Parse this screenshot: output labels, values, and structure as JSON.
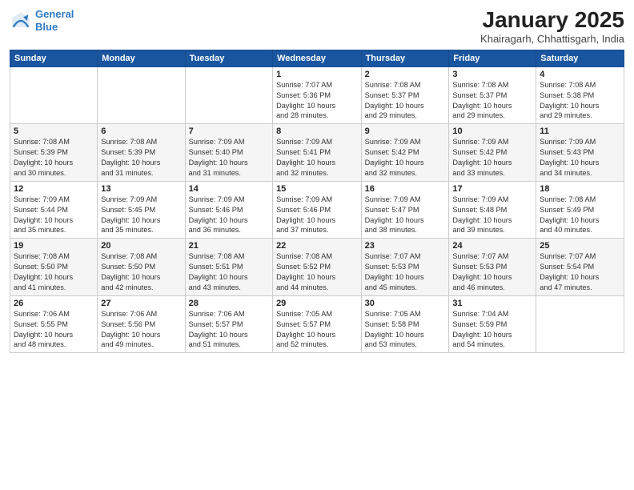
{
  "logo": {
    "line1": "General",
    "line2": "Blue"
  },
  "header": {
    "title": "January 2025",
    "subtitle": "Khairagarh, Chhattisgarh, India"
  },
  "weekdays": [
    "Sunday",
    "Monday",
    "Tuesday",
    "Wednesday",
    "Thursday",
    "Friday",
    "Saturday"
  ],
  "weeks": [
    [
      {
        "day": "",
        "info": ""
      },
      {
        "day": "",
        "info": ""
      },
      {
        "day": "",
        "info": ""
      },
      {
        "day": "1",
        "info": "Sunrise: 7:07 AM\nSunset: 5:36 PM\nDaylight: 10 hours\nand 28 minutes."
      },
      {
        "day": "2",
        "info": "Sunrise: 7:08 AM\nSunset: 5:37 PM\nDaylight: 10 hours\nand 29 minutes."
      },
      {
        "day": "3",
        "info": "Sunrise: 7:08 AM\nSunset: 5:37 PM\nDaylight: 10 hours\nand 29 minutes."
      },
      {
        "day": "4",
        "info": "Sunrise: 7:08 AM\nSunset: 5:38 PM\nDaylight: 10 hours\nand 29 minutes."
      }
    ],
    [
      {
        "day": "5",
        "info": "Sunrise: 7:08 AM\nSunset: 5:39 PM\nDaylight: 10 hours\nand 30 minutes."
      },
      {
        "day": "6",
        "info": "Sunrise: 7:08 AM\nSunset: 5:39 PM\nDaylight: 10 hours\nand 31 minutes."
      },
      {
        "day": "7",
        "info": "Sunrise: 7:09 AM\nSunset: 5:40 PM\nDaylight: 10 hours\nand 31 minutes."
      },
      {
        "day": "8",
        "info": "Sunrise: 7:09 AM\nSunset: 5:41 PM\nDaylight: 10 hours\nand 32 minutes."
      },
      {
        "day": "9",
        "info": "Sunrise: 7:09 AM\nSunset: 5:42 PM\nDaylight: 10 hours\nand 32 minutes."
      },
      {
        "day": "10",
        "info": "Sunrise: 7:09 AM\nSunset: 5:42 PM\nDaylight: 10 hours\nand 33 minutes."
      },
      {
        "day": "11",
        "info": "Sunrise: 7:09 AM\nSunset: 5:43 PM\nDaylight: 10 hours\nand 34 minutes."
      }
    ],
    [
      {
        "day": "12",
        "info": "Sunrise: 7:09 AM\nSunset: 5:44 PM\nDaylight: 10 hours\nand 35 minutes."
      },
      {
        "day": "13",
        "info": "Sunrise: 7:09 AM\nSunset: 5:45 PM\nDaylight: 10 hours\nand 35 minutes."
      },
      {
        "day": "14",
        "info": "Sunrise: 7:09 AM\nSunset: 5:46 PM\nDaylight: 10 hours\nand 36 minutes."
      },
      {
        "day": "15",
        "info": "Sunrise: 7:09 AM\nSunset: 5:46 PM\nDaylight: 10 hours\nand 37 minutes."
      },
      {
        "day": "16",
        "info": "Sunrise: 7:09 AM\nSunset: 5:47 PM\nDaylight: 10 hours\nand 38 minutes."
      },
      {
        "day": "17",
        "info": "Sunrise: 7:09 AM\nSunset: 5:48 PM\nDaylight: 10 hours\nand 39 minutes."
      },
      {
        "day": "18",
        "info": "Sunrise: 7:08 AM\nSunset: 5:49 PM\nDaylight: 10 hours\nand 40 minutes."
      }
    ],
    [
      {
        "day": "19",
        "info": "Sunrise: 7:08 AM\nSunset: 5:50 PM\nDaylight: 10 hours\nand 41 minutes."
      },
      {
        "day": "20",
        "info": "Sunrise: 7:08 AM\nSunset: 5:50 PM\nDaylight: 10 hours\nand 42 minutes."
      },
      {
        "day": "21",
        "info": "Sunrise: 7:08 AM\nSunset: 5:51 PM\nDaylight: 10 hours\nand 43 minutes."
      },
      {
        "day": "22",
        "info": "Sunrise: 7:08 AM\nSunset: 5:52 PM\nDaylight: 10 hours\nand 44 minutes."
      },
      {
        "day": "23",
        "info": "Sunrise: 7:07 AM\nSunset: 5:53 PM\nDaylight: 10 hours\nand 45 minutes."
      },
      {
        "day": "24",
        "info": "Sunrise: 7:07 AM\nSunset: 5:53 PM\nDaylight: 10 hours\nand 46 minutes."
      },
      {
        "day": "25",
        "info": "Sunrise: 7:07 AM\nSunset: 5:54 PM\nDaylight: 10 hours\nand 47 minutes."
      }
    ],
    [
      {
        "day": "26",
        "info": "Sunrise: 7:06 AM\nSunset: 5:55 PM\nDaylight: 10 hours\nand 48 minutes."
      },
      {
        "day": "27",
        "info": "Sunrise: 7:06 AM\nSunset: 5:56 PM\nDaylight: 10 hours\nand 49 minutes."
      },
      {
        "day": "28",
        "info": "Sunrise: 7:06 AM\nSunset: 5:57 PM\nDaylight: 10 hours\nand 51 minutes."
      },
      {
        "day": "29",
        "info": "Sunrise: 7:05 AM\nSunset: 5:57 PM\nDaylight: 10 hours\nand 52 minutes."
      },
      {
        "day": "30",
        "info": "Sunrise: 7:05 AM\nSunset: 5:58 PM\nDaylight: 10 hours\nand 53 minutes."
      },
      {
        "day": "31",
        "info": "Sunrise: 7:04 AM\nSunset: 5:59 PM\nDaylight: 10 hours\nand 54 minutes."
      },
      {
        "day": "",
        "info": ""
      }
    ]
  ]
}
